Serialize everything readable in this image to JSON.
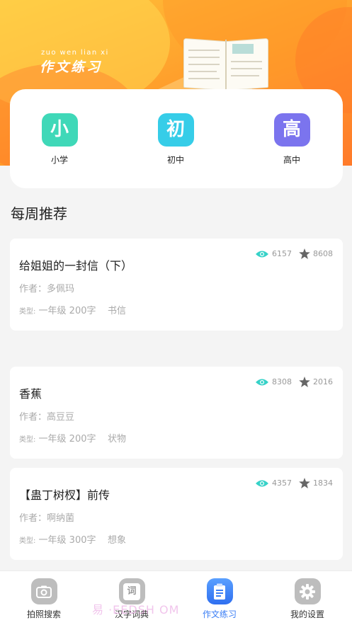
{
  "header": {
    "pinyin": "zuo wen lian xi",
    "title": "作文练习"
  },
  "levels": [
    {
      "glyph": "小",
      "label": "小学",
      "color": "#3fd8b8"
    },
    {
      "glyph": "初",
      "label": "初中",
      "color": "#36cde8"
    },
    {
      "glyph": "高",
      "label": "高中",
      "color": "#7b74ee"
    }
  ],
  "section_title": "每周推荐",
  "articles": [
    {
      "title": "给姐姐的一封信（下）",
      "author": "作者：多佩玛",
      "type_prefix": "类型:",
      "grade": "一年级",
      "words": "200字",
      "genre": "书信",
      "views": "6157",
      "stars": "8608"
    },
    {
      "title": "香蕉",
      "author": "作者：高豆豆",
      "type_prefix": "类型:",
      "grade": "一年级",
      "words": "200字",
      "genre": "状物",
      "views": "8308",
      "stars": "2016"
    },
    {
      "title": "【蛊丁树杈】前传",
      "author": "作者：啊纳菌",
      "type_prefix": "类型:",
      "grade": "一年级",
      "words": "300字",
      "genre": "想象",
      "views": "4357",
      "stars": "1834"
    }
  ],
  "nav": [
    {
      "label": "拍照搜索",
      "icon": "camera-icon"
    },
    {
      "label": "汉字词典",
      "icon": "dictionary-icon",
      "glyph": "词"
    },
    {
      "label": "作文练习",
      "icon": "essay-icon",
      "active": true
    },
    {
      "label": "我的设置",
      "icon": "gear-icon"
    }
  ],
  "watermark": "易 ·EEDSH OM",
  "colors": {
    "accent": "#3a7ef5",
    "eye": "#36d2c8",
    "star": "#666666",
    "banner": "#ff9b2a"
  }
}
